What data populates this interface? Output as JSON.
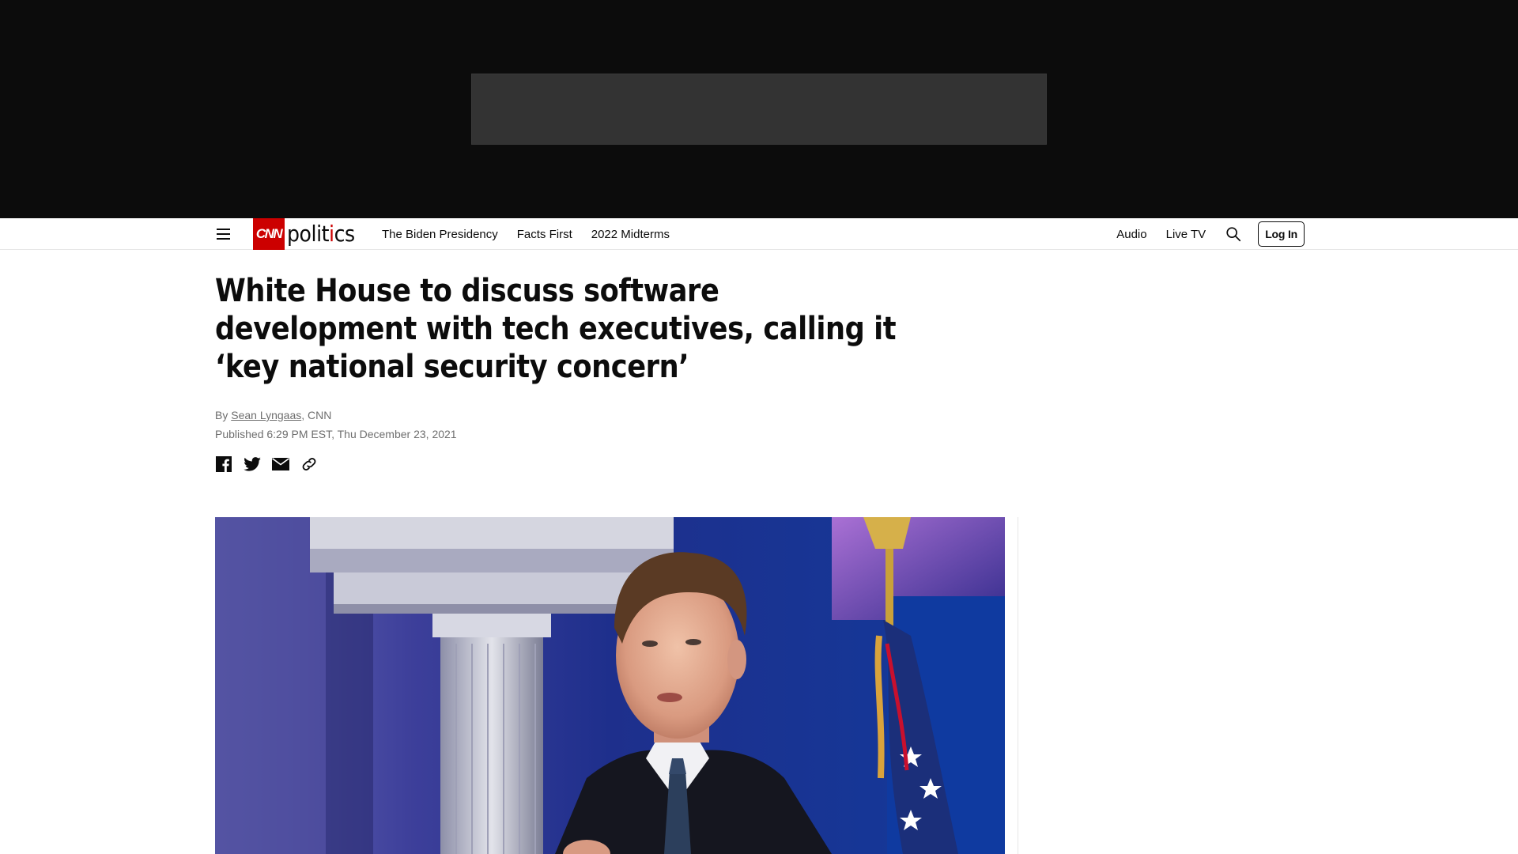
{
  "header": {
    "logo_brand": "CNN",
    "logo_section_prefix": "polit",
    "logo_section_accent": "i",
    "logo_section_suffix": "cs",
    "nav_left": [
      "The Biden Presidency",
      "Facts First",
      "2022 Midterms"
    ],
    "nav_right": [
      "Audio",
      "Live TV"
    ],
    "login_label": "Log In",
    "brand_color": "#cc0000"
  },
  "article": {
    "headline": "White House to discuss software development with tech executives, calling it ‘key national security concern’",
    "byline_prefix": "By ",
    "author": "Sean Lyngaas",
    "byline_suffix": ", CNN",
    "published": "Published 6:29 PM EST, Thu December 23, 2021"
  },
  "share": {
    "icons": [
      "facebook-icon",
      "twitter-icon",
      "email-icon",
      "link-icon"
    ]
  },
  "colors": {
    "ad_band": "#0c0c0c",
    "ad_slot": "#333333",
    "meta_text": "#6e6e6e"
  }
}
